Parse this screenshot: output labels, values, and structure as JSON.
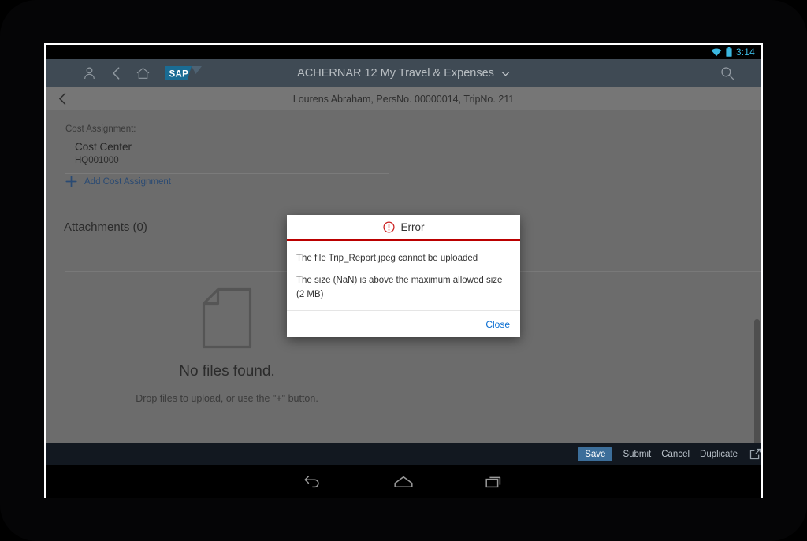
{
  "device": {
    "statusbar": {
      "clock": "3:14",
      "wifi_icon": "wifi-icon",
      "battery_icon": "battery-icon"
    },
    "navbar": {
      "back": "back-nav-icon",
      "home": "home-nav-icon",
      "recents": "recents-nav-icon"
    }
  },
  "shellbar": {
    "icons": [
      {
        "name": "user-icon"
      },
      {
        "name": "back-icon"
      },
      {
        "name": "home-icon"
      }
    ],
    "logo_alt": "SAP",
    "title": "ACHERNAR 12 My Travel & Expenses",
    "dropdown_icon": "chevron-down-icon",
    "search_icon": "search-icon"
  },
  "subheader": {
    "back_icon": "chevron-left-icon",
    "title": "Lourens Abraham, PersNo. 00000014, TripNo. 211"
  },
  "content": {
    "cost_assignment_label": "Cost Assignment:",
    "cost_center_title": "Cost Center",
    "cost_center_value": "HQ001000",
    "add_cost_assignment": "Add Cost Assignment",
    "add_icon": "plus-icon",
    "attachments_title": "Attachments (0)",
    "empty_state": {
      "icon": "document-icon",
      "heading": "No files found.",
      "subtext": "Drop files to upload, or use the \"+\" button."
    }
  },
  "footer": {
    "save": "Save",
    "submit": "Submit",
    "cancel": "Cancel",
    "duplicate": "Duplicate",
    "share_icon": "share-icon"
  },
  "dialog": {
    "icon": "error-icon",
    "title": "Error",
    "line1": "The file Trip_Report.jpeg cannot be uploaded",
    "line2": "The size (NaN) is above the maximum allowed size (2 MB)",
    "close": "Close"
  },
  "colors": {
    "shellbar": "#3f4a54",
    "subheader": "#767676",
    "content": "#6c6c6c",
    "footer": "#121820",
    "primary_button": "#3c6e9a",
    "error_red": "#bb0000",
    "link_blue": "#0a6ed1",
    "clock_cyan": "#3bb7e0"
  }
}
